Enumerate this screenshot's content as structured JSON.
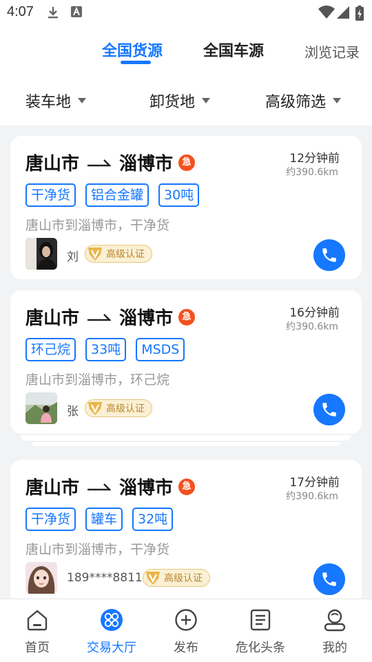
{
  "status_bar": {
    "time": "4:07"
  },
  "top_tabs": {
    "tabs": [
      "全国货源",
      "全国车源"
    ],
    "active_index": 0,
    "history_link": "浏览记录"
  },
  "filters": [
    "装车地",
    "卸货地",
    "高级筛选"
  ],
  "cards": [
    {
      "from": "唐山市",
      "to": "淄博市",
      "urgent_label": "急",
      "time_ago": "12分钟前",
      "distance": "约390.6km",
      "tags": [
        "干净货",
        "铝合金罐",
        "30吨"
      ],
      "desc": "唐山市到淄博市，干净货",
      "user": "刘",
      "badge": "高级认证"
    },
    {
      "from": "唐山市",
      "to": "淄博市",
      "urgent_label": "急",
      "time_ago": "16分钟前",
      "distance": "约390.6km",
      "tags": [
        "环己烷",
        "33吨",
        "MSDS"
      ],
      "desc": "唐山市到淄博市，环己烷",
      "user": "张",
      "badge": "高级认证"
    },
    {
      "from": "唐山市",
      "to": "淄博市",
      "urgent_label": "急",
      "time_ago": "17分钟前",
      "distance": "约390.6km",
      "tags": [
        "干净货",
        "罐车",
        "32吨"
      ],
      "desc": "唐山市到淄博市，干净货",
      "user": "189****8811",
      "badge": "高级认证"
    }
  ],
  "bottom_nav": {
    "items": [
      {
        "label": "首页",
        "icon": "home-icon"
      },
      {
        "label": "交易大厅",
        "icon": "hall-icon"
      },
      {
        "label": "发布",
        "icon": "plus-circle-icon"
      },
      {
        "label": "危化头条",
        "icon": "news-icon"
      },
      {
        "label": "我的",
        "icon": "profile-icon"
      }
    ],
    "active_index": 1
  },
  "colors": {
    "accent": "#1677ff",
    "urgent": "#f4511e",
    "badge_gold": "#b8862b"
  }
}
